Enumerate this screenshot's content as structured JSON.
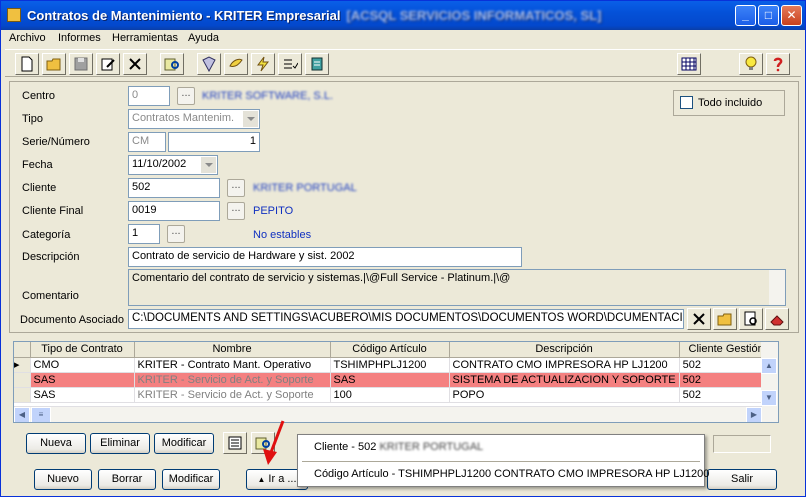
{
  "window": {
    "title": "Contratos de Mantenimiento - KRITER Empresarial",
    "title_suffix": "[ACSQL SERVICIOS INFORMATICOS, SL]"
  },
  "menu": [
    "Archivo",
    "Informes",
    "Herramientas",
    "Ayuda"
  ],
  "form": {
    "centro": {
      "label": "Centro",
      "value": "0",
      "desc": "KRITER SOFTWARE, S.L."
    },
    "tipo": {
      "label": "Tipo",
      "value": "Contratos Mantenim."
    },
    "serie_numero": {
      "label": "Serie/Número",
      "serie": "CM",
      "numero": "1"
    },
    "fecha": {
      "label": "Fecha",
      "value": "11/10/2002"
    },
    "cliente": {
      "label": "Cliente",
      "value": "502",
      "desc": "KRITER PORTUGAL"
    },
    "cliente_final": {
      "label": "Cliente Final",
      "value": "0019",
      "desc": "PEPITO"
    },
    "categoria": {
      "label": "Categoría",
      "value": "1",
      "desc": "No estables"
    },
    "descripcion": {
      "label": "Descripción",
      "value": "Contrato de servicio de Hardware y sist. 2002"
    },
    "comentario": {
      "label": "Comentario",
      "value": "Comentario del contrato de servicio y sistemas.|\\@Full Service - Platinum.|\\@"
    },
    "documento": {
      "label": "Documento Asociado",
      "value": "C:\\DOCUMENTS AND SETTINGS\\ACUBERO\\MIS DOCUMENTOS\\DOCUMENTOS WORD\\DCUMENTACION G"
    },
    "todo_incluido": {
      "label": "Todo incluido",
      "checked": false
    },
    "lookup_label": "..."
  },
  "grid": {
    "columns": [
      "Tipo de Contrato",
      "Nombre",
      "Código Artículo",
      "Descripción",
      "Cliente Gestión"
    ],
    "rows": [
      {
        "tipo": "CMO",
        "nombre": "KRITER - Contrato Mant. Operativo",
        "codigo": "TSHIMPHPLJ1200",
        "descripcion": "CONTRATO CMO IMPRESORA HP LJ1200",
        "cliente": "502"
      },
      {
        "tipo": "SAS",
        "nombre": "KRITER - Servicio de Act. y Soporte",
        "codigo": "SAS",
        "descripcion": "SISTEMA DE ACTUALIZACION Y SOPORTE",
        "cliente": "502"
      },
      {
        "tipo": "SAS",
        "nombre": "KRITER - Servicio de Act. y Soporte",
        "codigo": "100",
        "descripcion": "POPO",
        "cliente": "502"
      }
    ]
  },
  "grid_buttons": {
    "nueva": "Nueva",
    "eliminar": "Eliminar",
    "modificar": "Modificar"
  },
  "bottom_buttons": {
    "nuevo": "Nuevo",
    "borrar": "Borrar",
    "modificar": "Modificar",
    "ir_a": "Ir a ...",
    "salir": "Salir"
  },
  "popup": {
    "item1_prefix": "Cliente - 502",
    "item1_blur": "KRITER PORTUGAL",
    "item2": "Código Artículo - TSHIMPHPLJ1200 CONTRATO CMO IMPRESORA HP LJ1200"
  },
  "colors": {
    "selected_row": "#f48080",
    "titlebar": "#0451d8",
    "link_blue": "#1030c0",
    "arrow": "#e01010"
  }
}
